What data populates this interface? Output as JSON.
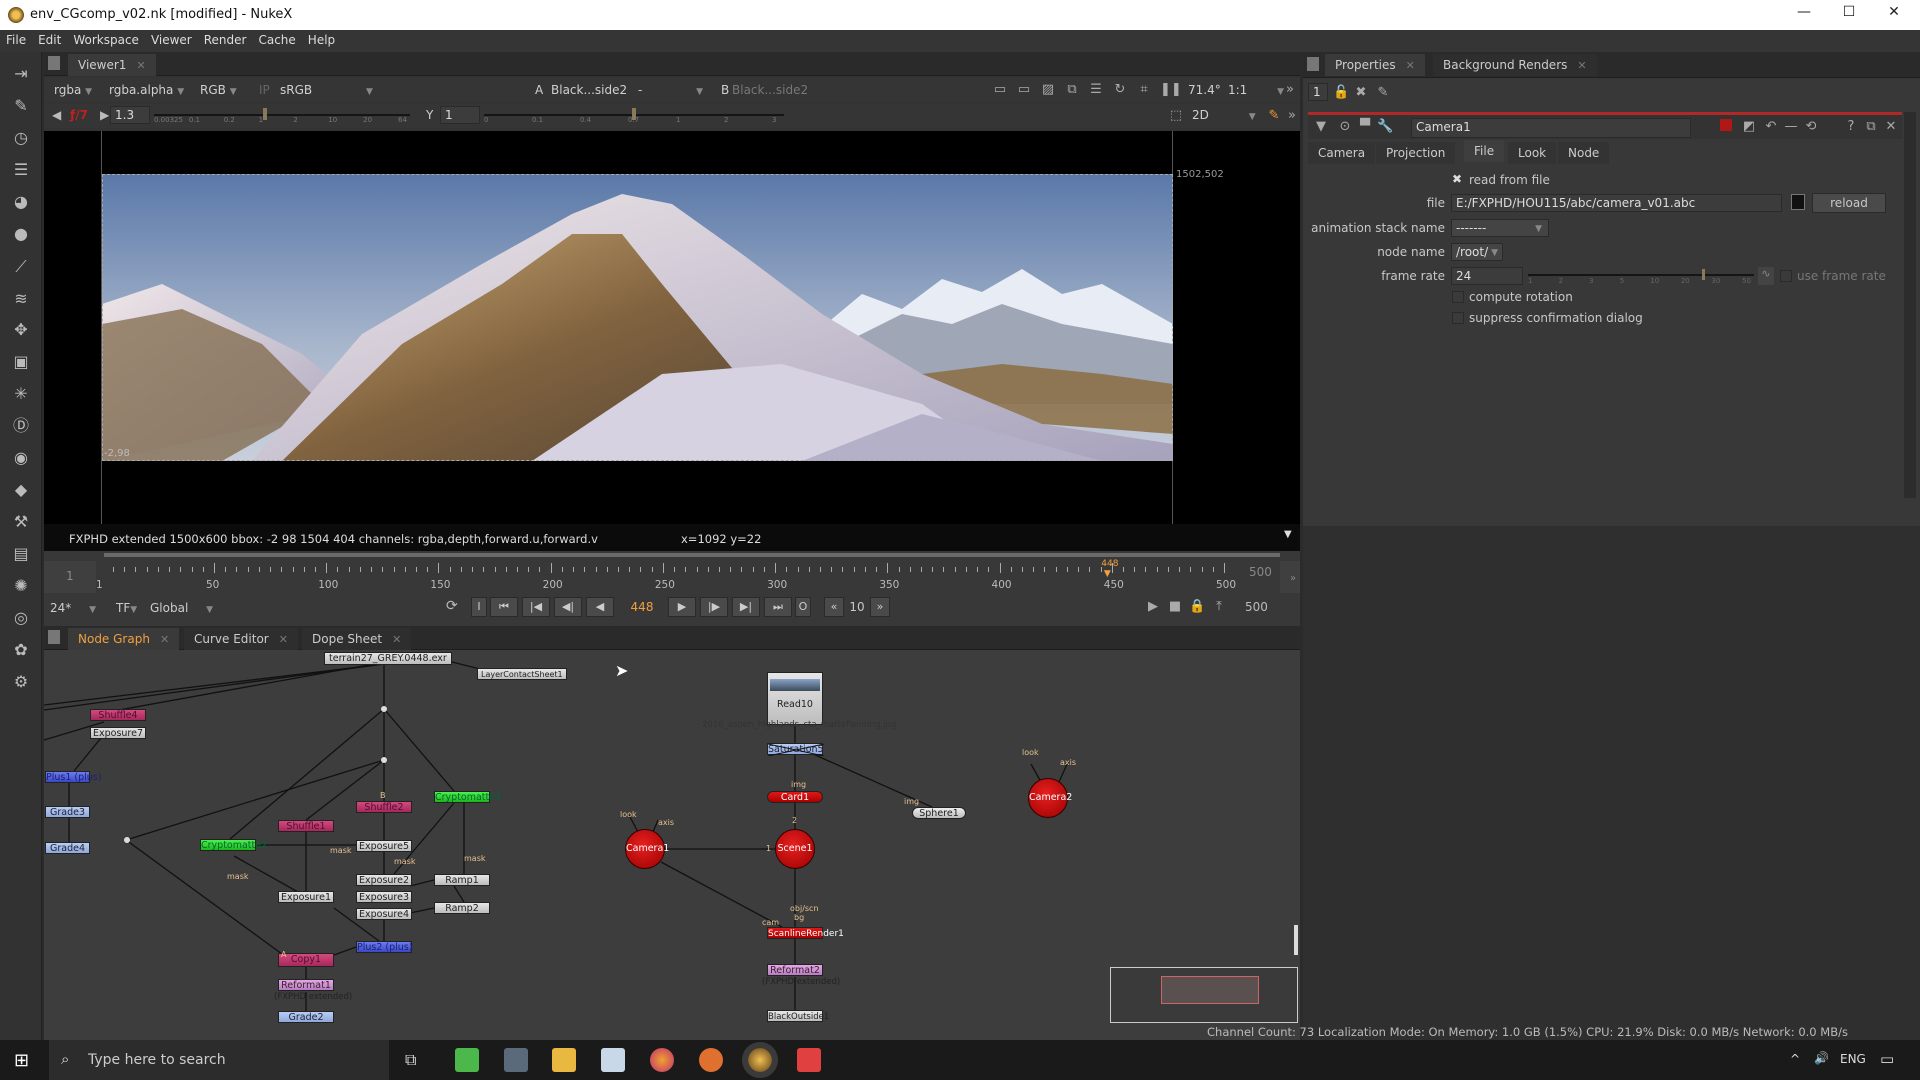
{
  "window": {
    "title": "env_CGcomp_v02.nk [modified] - NukeX",
    "minimize": "—",
    "maximize": "☐",
    "close": "✕"
  },
  "menu": [
    "File",
    "Edit",
    "Workspace",
    "Viewer",
    "Render",
    "Cache",
    "Help"
  ],
  "viewer": {
    "tab": "Viewer1",
    "channels": "rgba",
    "alpha": "rgba.alpha",
    "display": "RGB",
    "ip": "IP",
    "lut": "sRGB",
    "input_a_label": "A",
    "input_a": "Black...side2",
    "compare": "-",
    "input_b_label": "B",
    "input_b": "Black...side2",
    "zoom_fov": "71.4°",
    "zoom_ratio": "1:1",
    "fstop": "ƒ/7",
    "gain": "1.3",
    "gamma_label": "Y",
    "gamma": "1",
    "gain_ticks": [
      "0.00325",
      "0.1",
      "0.2",
      "1",
      "2",
      "10",
      "20",
      "64"
    ],
    "gamma_ticks": [
      "0",
      "0.1",
      "0.4",
      "0.7",
      "1",
      "2",
      "3"
    ],
    "view_mode": "2D",
    "format_corner_tr": "1502,502",
    "format_corner_bl": "-2,98",
    "info": "FXPHD extended 1500x600  bbox: -2 98 1504 404 channels: rgba,depth,forward.u,forward.v",
    "cursor": "x=1092 y=22"
  },
  "timeline": {
    "start": "1",
    "end": "500",
    "current": "448",
    "tick_labels": [
      "1",
      "50",
      "100",
      "150",
      "200",
      "250",
      "300",
      "350",
      "400",
      "450",
      "500"
    ],
    "fps": "24*",
    "tf": "TF",
    "range": "Global",
    "current_frame": "448",
    "increment": "10",
    "in_point": "I",
    "out_point": "O",
    "end_frame": "500"
  },
  "bottom_tabs": [
    "Node Graph",
    "Curve Editor",
    "Dope Sheet"
  ],
  "nodes": {
    "read_top": "terrain27_GREY.0448.exr",
    "layer_contact": "LayerContactSheet1",
    "shuffle4": "Shuffle4",
    "exposure7": "Exposure7",
    "plus1": "Plus1 (plus)",
    "grade3": "Grade3",
    "grade4": "Grade4",
    "crypto2": "Cryptomatte2",
    "shuffle1": "Shuffle1",
    "shuffle2": "Shuffle2",
    "crypto1": "Cryptomatte1",
    "exposure5": "Exposure5",
    "exposure1": "Exposure1",
    "exposure2": "Exposure2",
    "exposure3": "Exposure3",
    "exposure4": "Exposure4",
    "ramp1": "Ramp1",
    "ramp2": "Ramp2",
    "plus2": "Plus2 (plus)",
    "copy1": "Copy1",
    "reformat1": "Reformat1",
    "reformat_sub": "(FXPHD extended)",
    "grade2": "Grade2",
    "read10": "Read10",
    "read10_file": "2016_aspen_highlands_cta_mattePainting.jpg",
    "saturation5": "Saturation5",
    "card1": "Card1",
    "sphere1": "Sphere1",
    "camera1": "Camera1",
    "camera2": "Camera2",
    "scene1": "Scene1",
    "scanline": "ScanlineRender1",
    "reformat2": "Reformat2",
    "blackoutside": "BlackOutside1",
    "port_labels": {
      "mask": "mask",
      "look": "look",
      "axis": "axis",
      "img": "img",
      "cam": "cam",
      "obj": "obj/scn",
      "bg": "bg",
      "a": "A",
      "b": "B",
      "one": "1",
      "two": "2"
    }
  },
  "properties": {
    "tabs": [
      "Properties",
      "Background Renders"
    ],
    "max_panels": "1",
    "node_name": "Camera1",
    "knob_tabs": [
      "Camera",
      "Projection",
      "File",
      "Look",
      "Node"
    ],
    "active_tab": "File",
    "read_from_file": "read from file",
    "file_label": "file",
    "file_value": "E:/FXPHD/HOU115/abc/camera_v01.abc",
    "reload": "reload",
    "anim_stack_label": "animation stack name",
    "anim_stack_value": "-------",
    "node_name_label": "node name",
    "node_name_value": "/root/",
    "frame_rate_label": "frame rate",
    "frame_rate_value": "24",
    "frame_rate_ticks": [
      "1",
      "2",
      "3",
      "5",
      "10",
      "20",
      "30",
      "50"
    ],
    "use_frame_rate": "use frame rate",
    "compute_rotation": "compute rotation",
    "suppress_dialog": "suppress confirmation dialog"
  },
  "status": "Channel Count: 73  Localization Mode: On  Memory: 1.0 GB (1.5%)  CPU: 21.9%  Disk: 0.0 MB/s  Network: 0.0 MB/s",
  "taskbar": {
    "search_placeholder": "Type here to search",
    "lang": "ENG"
  },
  "colors": {
    "accent": "#f0a040",
    "node_selected": "#e01818",
    "nuke_bg": "#333333"
  }
}
